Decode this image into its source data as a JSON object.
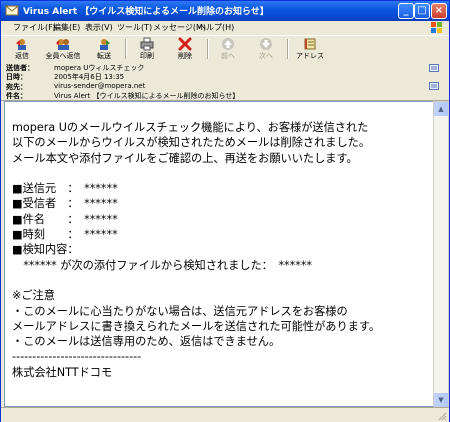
{
  "window": {
    "title": "Virus Alert 【ウイルス検知によるメール削除のお知らせ】",
    "controls": [
      "_",
      "□",
      "×"
    ]
  },
  "menu": [
    "ファイル(F)",
    "編集(E)",
    "表示(V)",
    "ツール(T)",
    "メッセージ(M)",
    "ヘルプ(H)"
  ],
  "toolbar": {
    "reply": "返信",
    "reply_all": "全員へ返信",
    "forward": "転送",
    "print": "印刷",
    "delete": "削除",
    "previous": "前へ",
    "next": "次へ",
    "addresses": "アドレス"
  },
  "headers": [
    {
      "label": "送信者：",
      "value": "mopera Uウィルスチェック"
    },
    {
      "label": "日時：",
      "value": "2005年4月6日 13:35"
    },
    {
      "label": "宛先：",
      "value": "virus-sender@mopera.net"
    },
    {
      "label": "件名：",
      "value": "Virus Alert 【ウイルス検知によるメール削除のお知らせ】"
    }
  ],
  "message_body": "mopera Uのメールウイルスチェック機能により、お客様が送信された\n以下のメールからウイルスが検知されたためメールは削除されました。\nメール本文や添付ファイルをご確認の上、再送をお願いいたします。\n\n■送信元　：　******\n■受信者　：　******\n■件名　　：　******\n■時刻　　：　******\n■検知内容：\n　****** が次の添付ファイルから検知されました：　******\n\n※ご注意\n・このメールに心当たりがない場合は、送信元アドレスをお客様の\nメールアドレスに書き換えられたメールを送信された可能性があります。\n・このメールは送信専用のため、返信はできません。\n--------------------------------\n株式会社NTTドコモ",
  "colors": {
    "titlebar": "#0a58e0",
    "chrome": "#ece9d8",
    "body_bg": "#ffffff"
  }
}
